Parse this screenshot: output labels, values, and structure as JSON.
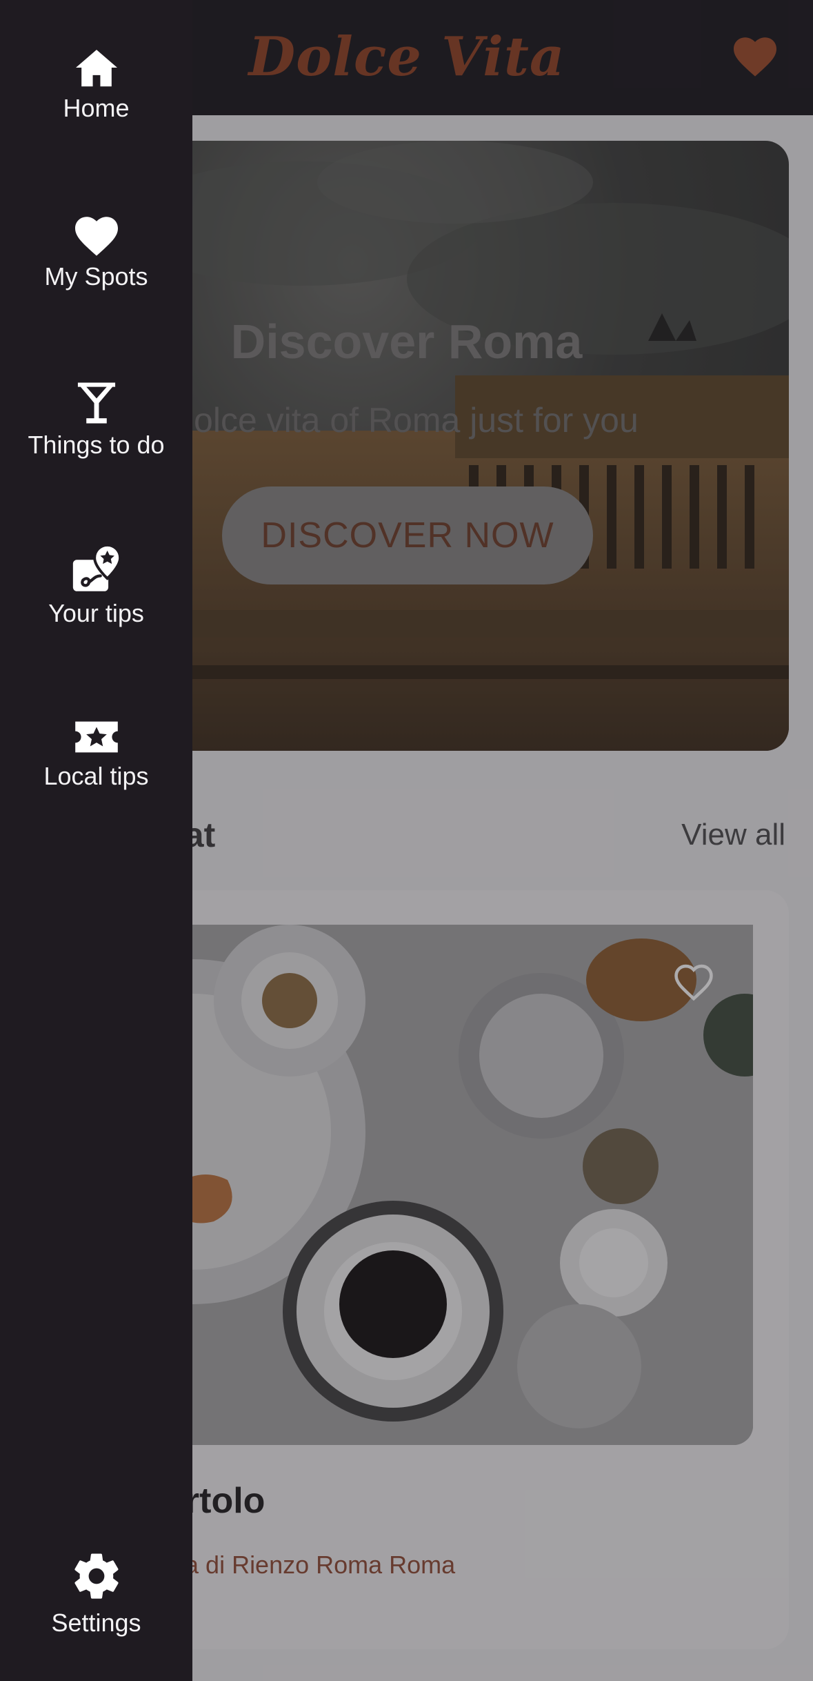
{
  "header": {
    "brand": "Dolce Vita"
  },
  "hero": {
    "title": "Discover Roma",
    "subtitle": "dolce vita of Roma just for you",
    "button_label": "DISCOVER NOW"
  },
  "section": {
    "title": "eat",
    "view_all": "View all"
  },
  "card": {
    "name": "artolo",
    "address": "ola di Rienzo Roma Roma"
  },
  "drawer": {
    "items": [
      {
        "label": "Home",
        "icon": "home-icon"
      },
      {
        "label": "My Spots",
        "icon": "heart-icon"
      },
      {
        "label": "Things to do",
        "icon": "cocktail-glass-icon"
      },
      {
        "label": "Your tips",
        "icon": "tips-location-icon"
      },
      {
        "label": "Local tips",
        "icon": "ticket-star-icon"
      }
    ],
    "settings": {
      "label": "Settings",
      "icon": "gear-icon"
    }
  },
  "colors": {
    "brand": "#8e3f21",
    "drawer_bg": "#1f1b21",
    "topbar_bg": "#18151b"
  }
}
